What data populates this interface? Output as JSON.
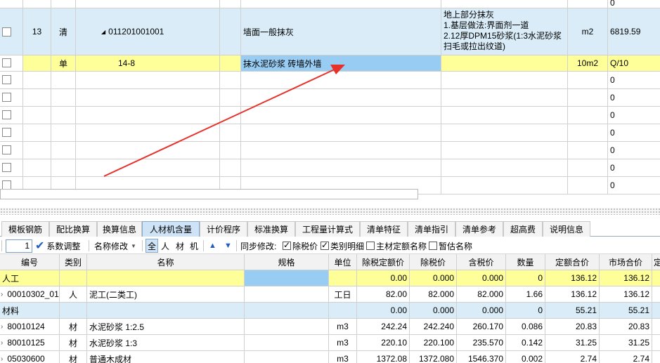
{
  "colors": {
    "yellow": "#ffff99",
    "light_blue": "#d9ecf7",
    "selected_blue": "#99ccf2",
    "arrow_red": "#e8302a"
  },
  "top_grid": {
    "top_partial_value": "0",
    "row_13": {
      "index": "13",
      "type": "清",
      "code": "011201001001",
      "name": "墙面一般抹灰",
      "feature_lines": [
        "地上部分抹灰",
        "1.基层做法:界面剂一道",
        "2.12厚DPM15砂浆(1:3水泥砂浆",
        "扫毛或拉出纹道)"
      ],
      "unit": "m2",
      "quantity": "6819.59"
    },
    "row_quota": {
      "type": "单",
      "code": "14-8",
      "name": "抹水泥砂浆 砖墙外墙",
      "unit": "10m2",
      "quantity": "Q/10"
    },
    "empty_value": "0"
  },
  "tabs": [
    "模板钢筋",
    "配比换算",
    "换算信息",
    "人材机含量",
    "计价程序",
    "标准换算",
    "工程量计算式",
    "清单特征",
    "清单指引",
    "清单参考",
    "超高费",
    "说明信息"
  ],
  "active_tab": "人材机含量",
  "toolbar": {
    "factor_value": "1",
    "coef_adjust": "系数调整",
    "name_modify": "名称修改",
    "filter_all": "全",
    "filter_labor": "人",
    "filter_material": "材",
    "filter_machine": "机",
    "sync_label": "同步修改:",
    "chk_tax_excl": "除税价",
    "chk_type_detail": "类别明细",
    "chk_main_name": "主材定额名称",
    "chk_temp_name": "暂估名称"
  },
  "bottom_grid": {
    "headers": [
      "编号",
      "类别",
      "名称",
      "规格",
      "单位",
      "除税定额价",
      "除税价",
      "含税价",
      "数量",
      "定额合价",
      "市场合价",
      "定"
    ],
    "rows": [
      {
        "kind": "group",
        "color": "yellow",
        "code": "人工",
        "type": "",
        "name": "",
        "spec": "",
        "unit": "",
        "quota_price": "0.00",
        "tax_excl_price": "0.000",
        "tax_incl_price": "0.000",
        "qty": "0",
        "quota_total": "136.12",
        "market_total": "136.12"
      },
      {
        "kind": "item",
        "color": "white",
        "code": "00010302_01",
        "type": "人",
        "name": "泥工(二类工)",
        "spec": "",
        "unit": "工日",
        "quota_price": "82.00",
        "tax_excl_price": "82.000",
        "tax_incl_price": "82.000",
        "qty": "1.66",
        "quota_total": "136.12",
        "market_total": "136.12"
      },
      {
        "kind": "group",
        "color": "blue",
        "code": "材料",
        "type": "",
        "name": "",
        "spec": "",
        "unit": "",
        "quota_price": "0.00",
        "tax_excl_price": "0.000",
        "tax_incl_price": "0.000",
        "qty": "0",
        "quota_total": "55.21",
        "market_total": "55.21"
      },
      {
        "kind": "item",
        "color": "white",
        "code": "80010124",
        "type": "材",
        "name": "水泥砂浆 1:2.5",
        "spec": "",
        "unit": "m3",
        "quota_price": "242.24",
        "tax_excl_price": "242.240",
        "tax_incl_price": "260.170",
        "qty": "0.086",
        "quota_total": "20.83",
        "market_total": "20.83"
      },
      {
        "kind": "item",
        "color": "white",
        "code": "80010125",
        "type": "材",
        "name": "水泥砂浆 1:3",
        "spec": "",
        "unit": "m3",
        "quota_price": "220.10",
        "tax_excl_price": "220.100",
        "tax_incl_price": "235.570",
        "qty": "0.142",
        "quota_total": "31.25",
        "market_total": "31.25"
      },
      {
        "kind": "item",
        "color": "white",
        "code": "05030600",
        "type": "材",
        "name": "普通木成材",
        "spec": "",
        "unit": "m3",
        "quota_price": "1372.08",
        "tax_excl_price": "1372.080",
        "tax_incl_price": "1546.370",
        "qty": "0.002",
        "quota_total": "2.74",
        "market_total": "2.74"
      }
    ]
  }
}
